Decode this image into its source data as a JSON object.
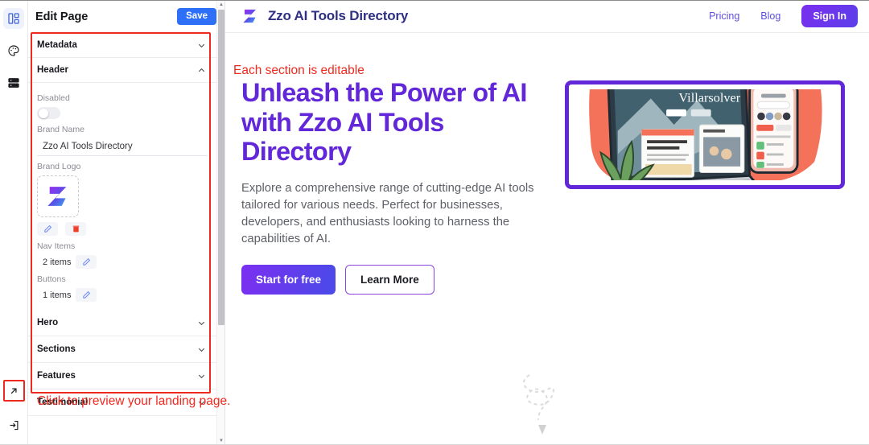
{
  "rail": {
    "items": [
      {
        "name": "layout-icon",
        "label": "Layout",
        "active": true
      },
      {
        "name": "palette-icon",
        "label": "Theme",
        "active": false
      },
      {
        "name": "database-icon",
        "label": "Data",
        "active": false
      }
    ],
    "bottom": [
      {
        "name": "external-link-icon",
        "label": "Preview",
        "highlighted": true
      },
      {
        "name": "logout-icon",
        "label": "Exit",
        "highlighted": false
      }
    ]
  },
  "panel": {
    "title": "Edit Page",
    "save_label": "Save",
    "sections": [
      {
        "label": "Metadata",
        "expanded": false
      },
      {
        "label": "Header",
        "expanded": true
      },
      {
        "label": "Hero",
        "expanded": false
      },
      {
        "label": "Sections",
        "expanded": false
      },
      {
        "label": "Features",
        "expanded": false
      },
      {
        "label": "Testimonial",
        "expanded": false
      }
    ],
    "header_form": {
      "disabled_label": "Disabled",
      "disabled_value": "off",
      "brand_name_label": "Brand Name",
      "brand_name_value": "Zzo AI Tools Directory",
      "brand_logo_label": "Brand Logo",
      "logo_edit_icon": "pencil-icon",
      "logo_delete_icon": "trash-icon",
      "nav_items_label": "Nav Items",
      "nav_items_value": "2 items",
      "buttons_label": "Buttons",
      "buttons_value": "1 items"
    }
  },
  "annotations": {
    "panel_note": "Click to preview your landing page.",
    "preview_note": "Each section is editable",
    "color": "#ee2a1f"
  },
  "preview": {
    "brand_name": "Zzo AI Tools Directory",
    "nav": [
      {
        "label": "Pricing"
      },
      {
        "label": "Blog"
      }
    ],
    "signin_label": "Sign In",
    "hero": {
      "title": "Unleash the Power of AI with Zzo AI Tools Directory",
      "subtitle": "Explore a comprehensive range of cutting-edge AI tools tailored for various needs. Perfect for businesses, developers, and enthusiasts looking to harness the capabilities of AI.",
      "primary_cta": "Start for free",
      "secondary_cta": "Learn More",
      "image_alt": "Laptop and smartphone illustration showing a website mockup"
    }
  },
  "colors": {
    "accent_purple": "#6127d8",
    "save_blue": "#2d6ff7",
    "annotation_red": "#ee2a1f",
    "brand_navy": "#2f3084"
  }
}
